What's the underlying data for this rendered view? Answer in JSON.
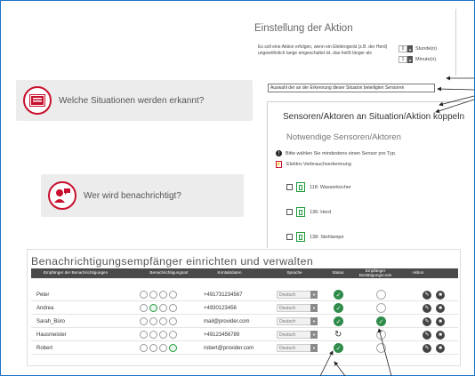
{
  "situations": {
    "card1_label": "Welche Situationen werden erkannt?",
    "card2_label": "Wer wird benachrichtigt?"
  },
  "settings": {
    "title": "Einstellung der Aktion",
    "description": "Es soll eine Aktion erfolgen, wenn ein Elektrogerät (z.B. der Herd) ungewöhnlich lange eingeschaltet ist, das heißt länger als",
    "hours_value": "0",
    "hours_unit": "Stunde(n)",
    "minutes_value": "1",
    "minutes_unit": "Minute(n)",
    "sensor_button": "Auswahl der an der Erkennung dieser Situaton beteiligten Sensoren"
  },
  "coupling": {
    "title": "Sensoren/Aktoren an Situation/Aktion koppeln",
    "required_title": "Notwendige Sensoren/Aktoren",
    "hint": "Bitte wählen Sie mindestens einen Sensor pro Typ.",
    "category": "Elektro-Verbrauchserkennung",
    "sensors": [
      "118: Wasserkocher",
      "136: Herd",
      "138: Stehlampe"
    ]
  },
  "recipients": {
    "title": "Benachrichtigungsempfänger einrichten und verwalten",
    "headers": {
      "name": "Empfänger der Benachrichtigungen",
      "type": "Benachrichtigungsart",
      "contact": "Kontaktdaten",
      "lang": "Sprache",
      "status": "Status",
      "confirm": "Empfänger Bestätigungscode",
      "action": "Aktion"
    },
    "rows": [
      {
        "name": "Peter",
        "contact": "+491731234567",
        "lang": "Deutsch"
      },
      {
        "name": "Andrea",
        "contact": "+4930123456",
        "lang": "Deutsch"
      },
      {
        "name": "Sarah_Büro",
        "contact": "mail@provider.com",
        "lang": "Deutsch"
      },
      {
        "name": "Hausmeister",
        "contact": "+49123456789",
        "lang": "Deutsch"
      },
      {
        "name": "Robert",
        "contact": "robert@provider.com",
        "lang": "Deutsch"
      }
    ]
  },
  "colors": {
    "accent_red": "#c8102e",
    "status_green": "#2e8b4a",
    "header_dark": "#4a4a4a"
  }
}
